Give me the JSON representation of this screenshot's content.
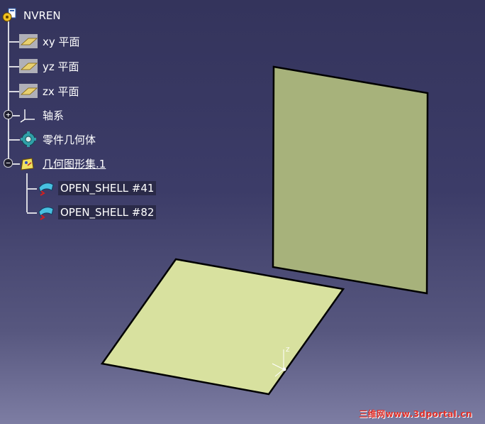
{
  "tree": {
    "root": {
      "label": "NVREN",
      "icon": "product-gear-icon"
    },
    "planes": [
      {
        "label": "xy 平面",
        "icon": "plane-icon"
      },
      {
        "label": "yz 平面",
        "icon": "plane-icon"
      },
      {
        "label": "zx 平面",
        "icon": "plane-icon"
      }
    ],
    "axis_system": {
      "label": "轴系",
      "icon": "axis-system-icon",
      "expander": "+"
    },
    "part_body": {
      "label": "零件几何体",
      "icon": "part-body-gear-icon"
    },
    "geometrical_set": {
      "label": "几何图形集.1",
      "icon": "geometrical-set-icon",
      "expander": "−"
    },
    "shells": [
      {
        "label": "OPEN_SHELL #41",
        "icon": "open-shell-icon"
      },
      {
        "label": "OPEN_SHELL #82",
        "icon": "open-shell-icon"
      }
    ]
  },
  "viewport": {
    "surface_colors": {
      "vertical": "#a7b27b",
      "horizontal": "#d8e19f",
      "edge": "#000000"
    },
    "axis_label": "Z"
  },
  "watermark": "三维网www.3dportal.cn"
}
